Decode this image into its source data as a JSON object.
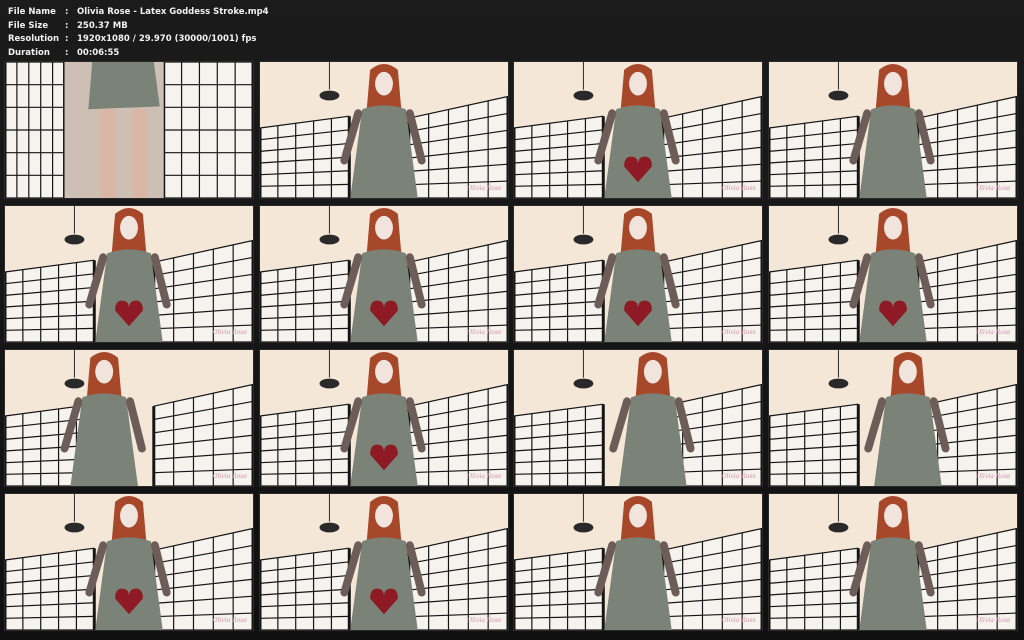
{
  "info": {
    "rows": [
      {
        "label": "File Name",
        "sep": ":",
        "value": "Olivia Rose - Latex Goddess Stroke.mp4"
      },
      {
        "label": "File Size",
        "sep": ":",
        "value": "250.37 MB"
      },
      {
        "label": "Resolution",
        "sep": ":",
        "value": "1920x1080 / 29.970 (30000/1001) fps"
      },
      {
        "label": "Duration",
        "sep": ":",
        "value": "00:06:55"
      }
    ]
  },
  "thumbnails": {
    "columns": 4,
    "rows": 4,
    "watermark": "Olivia Rose",
    "frames": [
      {
        "scene": "closeup-legs",
        "heart": false
      },
      {
        "scene": "standing",
        "heart": false
      },
      {
        "scene": "standing",
        "heart": true
      },
      {
        "scene": "standing",
        "heart": false
      },
      {
        "scene": "standing",
        "heart": true
      },
      {
        "scene": "standing",
        "heart": true
      },
      {
        "scene": "standing",
        "heart": true
      },
      {
        "scene": "standing",
        "heart": true
      },
      {
        "scene": "turned",
        "heart": false
      },
      {
        "scene": "standing",
        "heart": true
      },
      {
        "scene": "leaning",
        "heart": false
      },
      {
        "scene": "leaning",
        "heart": false
      },
      {
        "scene": "standing",
        "heart": true
      },
      {
        "scene": "standing",
        "heart": true
      },
      {
        "scene": "standing",
        "heart": false
      },
      {
        "scene": "standing",
        "heart": false
      }
    ]
  },
  "colors": {
    "latex": "#7b8277",
    "heart": "#8e1a25",
    "hair": "#a8482a",
    "sky": "#f4e7d8",
    "screen_frame": "#141414"
  }
}
